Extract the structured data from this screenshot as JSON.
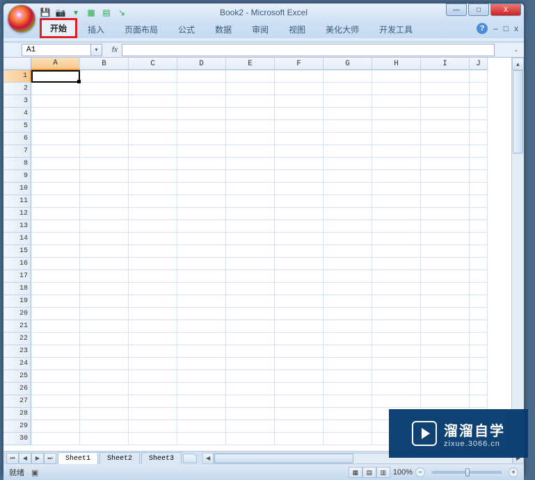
{
  "title": "Book2 - Microsoft Excel",
  "qat_icons": [
    "save-icon",
    "camera-icon",
    "table-icon",
    "grid-icon",
    "arrow-icon"
  ],
  "win": {
    "min": "—",
    "max": "□",
    "close": "X"
  },
  "tabs": [
    "开始",
    "插入",
    "页面布局",
    "公式",
    "数据",
    "审阅",
    "视图",
    "美化大师",
    "开发工具"
  ],
  "highlighted_tab": "开始",
  "ribbon_right": {
    "help": "?",
    "min": "–",
    "restore": "□",
    "close": "x"
  },
  "namebox": "A1",
  "fx_label": "fx",
  "columns": [
    "A",
    "B",
    "C",
    "D",
    "E",
    "F",
    "G",
    "H",
    "I",
    "J"
  ],
  "rows": [
    "1",
    "2",
    "3",
    "4",
    "5",
    "6",
    "7",
    "8",
    "9",
    "10",
    "11",
    "12",
    "13",
    "14",
    "15",
    "16",
    "17",
    "18",
    "19",
    "20",
    "21",
    "22",
    "23",
    "24",
    "25",
    "26",
    "27",
    "28",
    "29",
    "30"
  ],
  "active_col": "A",
  "active_row": "1",
  "sheet_tabs": [
    "Sheet1",
    "Sheet2",
    "Sheet3"
  ],
  "active_sheet": "Sheet1",
  "status": "就绪",
  "zoom": "100%",
  "zoom_minus": "−",
  "zoom_plus": "+",
  "watermark": {
    "cn": "溜溜自学",
    "en": "zixue.3066.cn"
  }
}
